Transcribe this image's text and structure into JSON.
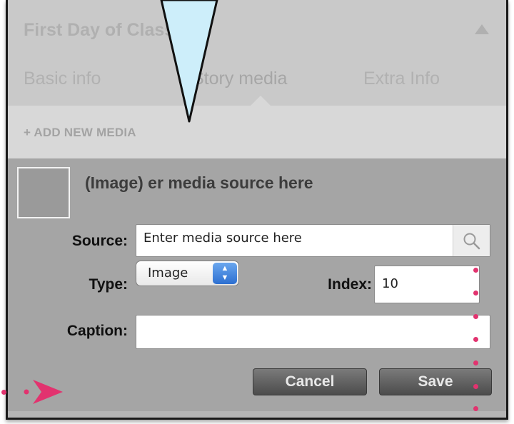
{
  "story": {
    "title": "First Day of Classes"
  },
  "tabs": [
    {
      "label": "Basic info"
    },
    {
      "label": "Story media",
      "active": true
    },
    {
      "label": "Extra Info"
    }
  ],
  "add_media": {
    "label": "+ ADD NEW MEDIA"
  },
  "media": {
    "title": "(Image) er media source here",
    "source": {
      "label": "Source:",
      "value": "Enter media source here"
    },
    "type": {
      "label": "Type:",
      "value": "Image"
    },
    "index": {
      "label": "Index:",
      "value": "10"
    },
    "caption": {
      "label": "Caption:",
      "value": ""
    }
  },
  "buttons": {
    "cancel": "Cancel",
    "save": "Save"
  },
  "icons": {
    "collapse": "triangle-up-icon",
    "search": "search-icon",
    "select_arrows": "up-down-arrows-icon",
    "callout": "callout-pointer-icon",
    "annotation_arrow": "arrow-right-icon"
  },
  "colors": {
    "panel": "#a5a5a5",
    "header": "#c9c9c9",
    "accent_pink": "#e2336f",
    "callout_fill": "#cdeefa",
    "select_blue": "#3b82e0"
  }
}
